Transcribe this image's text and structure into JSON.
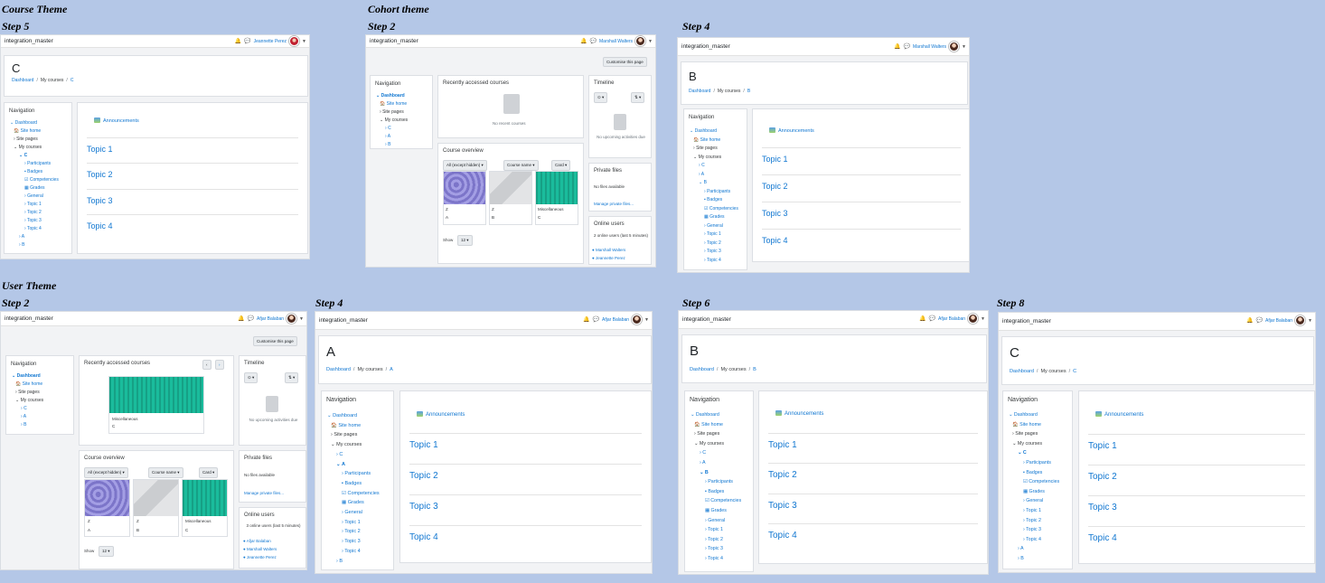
{
  "labels": {
    "course_theme": "Course Theme",
    "cohort_theme": "Cohort theme",
    "user_theme": "User Theme",
    "step2": "Step 2",
    "step4": "Step 4",
    "step5": "Step 5",
    "step6": "Step 6",
    "step8": "Step 8"
  },
  "site_name": "integration_master",
  "users": {
    "jp": "Jeannette Perez",
    "mw": "Marshall Walters",
    "ab": "Afjar Balaban"
  },
  "breadcrumb": {
    "dashboard": "Dashboard",
    "mycourses": "My courses",
    "sep": "/"
  },
  "courses": {
    "a": "A",
    "b": "B",
    "c": "C"
  },
  "nav": {
    "title": "Navigation",
    "dashboard": "Dashboard",
    "sitehome": "Site home",
    "sitepages": "Site pages",
    "mycourses": "My courses",
    "participants": "Participants",
    "badges": "Badges",
    "competencies": "Competencies",
    "grades": "Grades",
    "general": "General"
  },
  "topics": [
    "Topic 1",
    "Topic 2",
    "Topic 3",
    "Topic 4"
  ],
  "announcements": "Announcements",
  "dash": {
    "customise": "Customise this page",
    "recent": "Recently accessed courses",
    "no_recent": "No recent courses",
    "overview": "Course overview",
    "filter": "All (except hidden)",
    "sort": "Course name",
    "view": "Card",
    "show": "Show",
    "show_n": "12",
    "z": "Z",
    "misc": "Miscellaneous",
    "timeline": "Timeline",
    "no_upcoming": "No upcoming activities due",
    "private": "Private files",
    "no_files": "No files available",
    "manage": "Manage private files...",
    "online": "Online users",
    "online2": "2 online users (last 5 minutes)",
    "online3": "3 online users (last 5 minutes)"
  }
}
